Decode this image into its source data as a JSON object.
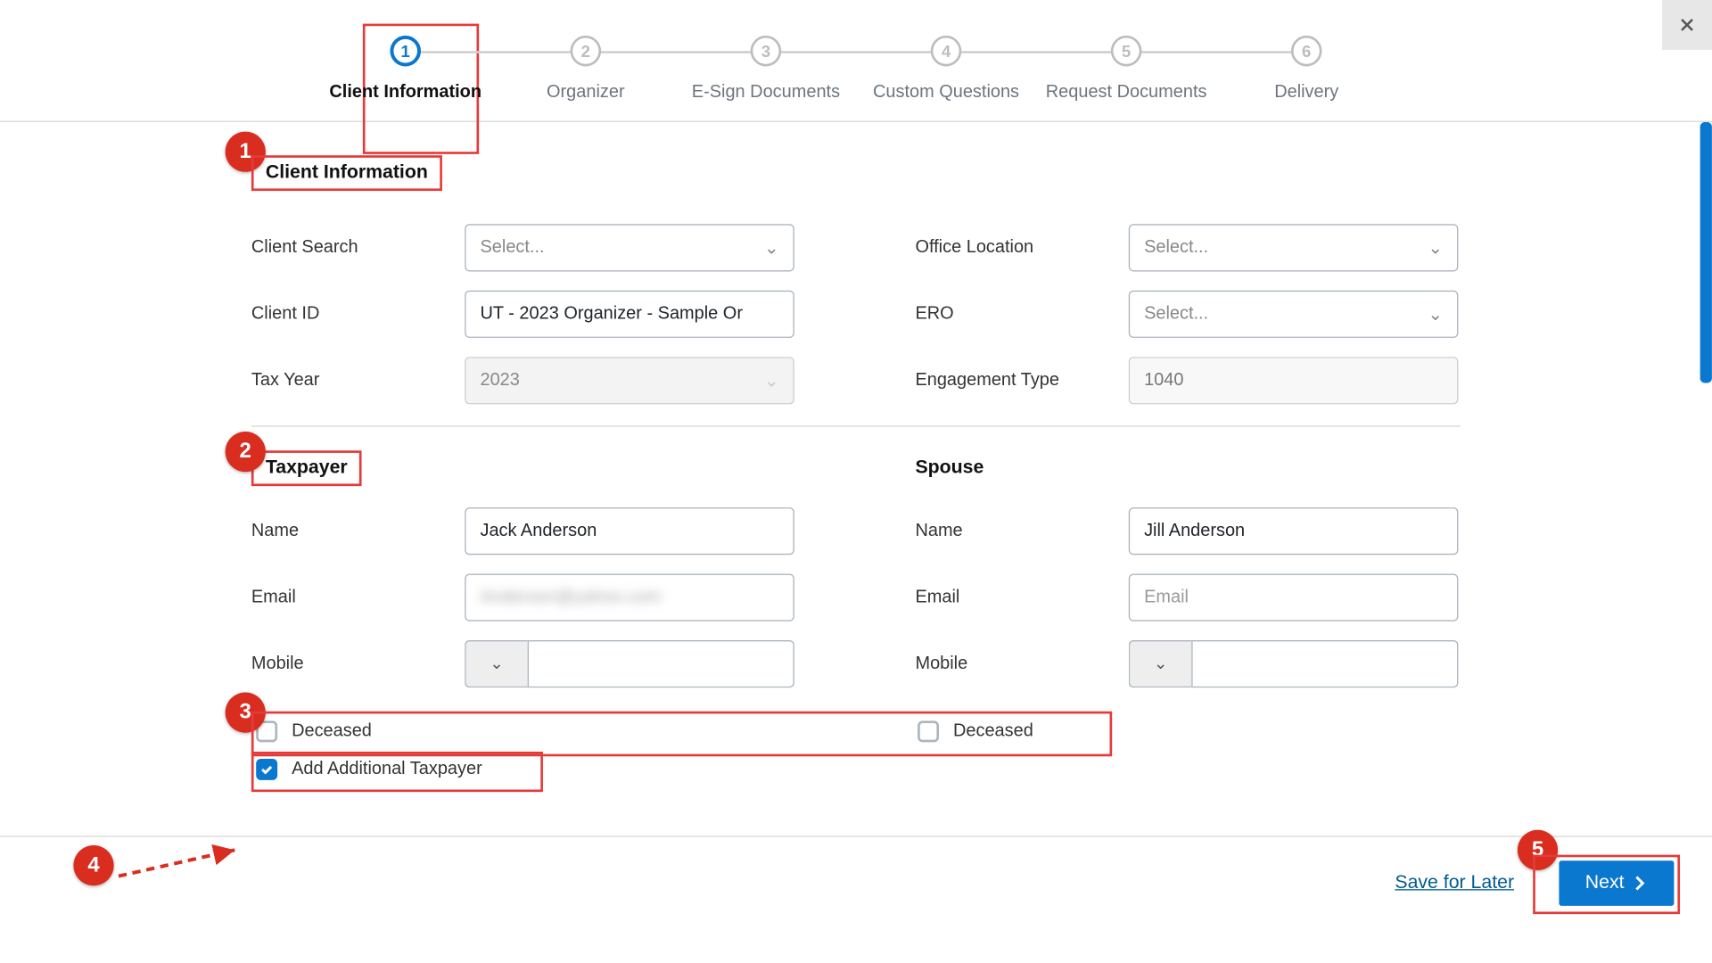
{
  "stepper": {
    "steps": [
      {
        "num": "1",
        "label": "Client Information"
      },
      {
        "num": "2",
        "label": "Organizer"
      },
      {
        "num": "3",
        "label": "E-Sign Documents"
      },
      {
        "num": "4",
        "label": "Custom Questions"
      },
      {
        "num": "5",
        "label": "Request Documents"
      },
      {
        "num": "6",
        "label": "Delivery"
      }
    ]
  },
  "section1": {
    "title": "Client Information",
    "client_search_label": "Client Search",
    "client_search_placeholder": "Select...",
    "client_id_label": "Client ID",
    "client_id_value": "UT - 2023 Organizer - Sample Or",
    "tax_year_label": "Tax Year",
    "tax_year_value": "2023",
    "office_loc_label": "Office Location",
    "office_loc_placeholder": "Select...",
    "ero_label": "ERO",
    "ero_placeholder": "Select...",
    "eng_type_label": "Engagement Type",
    "eng_type_value": "1040"
  },
  "section2": {
    "taxpayer_title": "Taxpayer",
    "spouse_title": "Spouse",
    "name_label": "Name",
    "email_label": "Email",
    "mobile_label": "Mobile",
    "taxpayer_name": "Jack Anderson",
    "taxpayer_email_obscured": "Anderson@yahoo.com",
    "spouse_name": "Jill Anderson",
    "spouse_email_placeholder": "Email",
    "deceased_label": "Deceased",
    "add_additional_label": "Add Additional Taxpayer"
  },
  "footer": {
    "save_label": "Save for Later",
    "next_label": "Next"
  },
  "annotations": {
    "b1": "1",
    "b2": "2",
    "b3": "3",
    "b4": "4",
    "b5": "5"
  }
}
